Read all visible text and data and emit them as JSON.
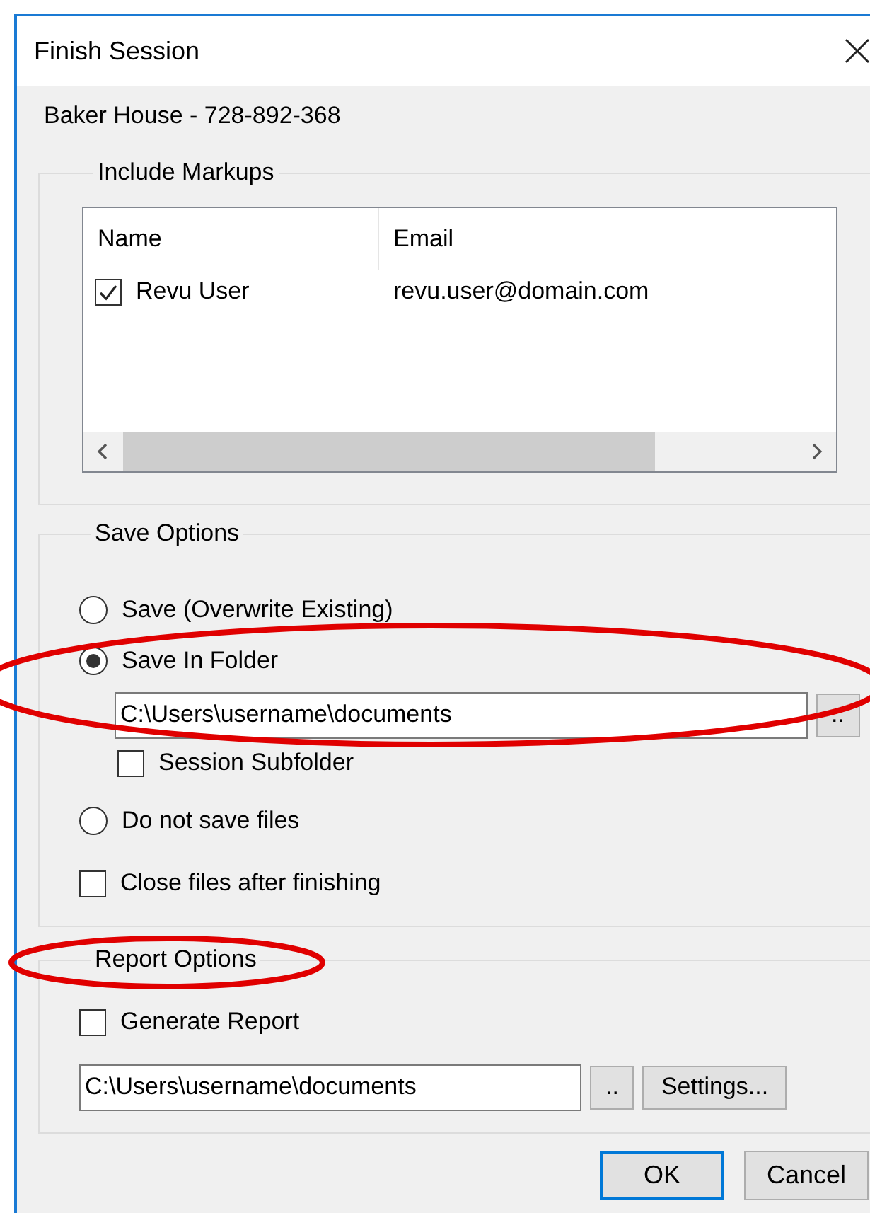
{
  "window": {
    "title": "Finish Session"
  },
  "project": "Baker House - 728-892-368",
  "include_markups": {
    "legend": "Include Markups",
    "columns": [
      "Name",
      "Email"
    ],
    "rows": [
      {
        "name": "Revu User",
        "email": "revu.user@domain.com",
        "checked": true
      }
    ]
  },
  "save_options": {
    "legend": "Save Options",
    "items": [
      {
        "kind": "radio",
        "label": "Save (Overwrite Existing)",
        "selected": false
      },
      {
        "kind": "radio",
        "label": "Save In Folder",
        "selected": true,
        "children": [
          {
            "kind": "field",
            "value": "C:\\Users\\username\\documents",
            "browse": ".."
          },
          {
            "kind": "checkbox",
            "label": "Session Subfolder",
            "checked": false
          }
        ]
      },
      {
        "kind": "radio",
        "label": "Do not save files",
        "selected": false
      },
      {
        "kind": "checkbox",
        "label": "Close files after finishing",
        "checked": false
      }
    ]
  },
  "report_options": {
    "legend": "Report Options",
    "items": [
      {
        "kind": "checkbox",
        "label": "Generate Report",
        "checked": false
      },
      {
        "kind": "field",
        "value": "C:\\Users\\username\\documents",
        "browse": "..",
        "settings": "Settings..."
      }
    ]
  },
  "buttons": [
    {
      "label": "OK",
      "default": true
    },
    {
      "label": "Cancel",
      "default": false
    }
  ]
}
